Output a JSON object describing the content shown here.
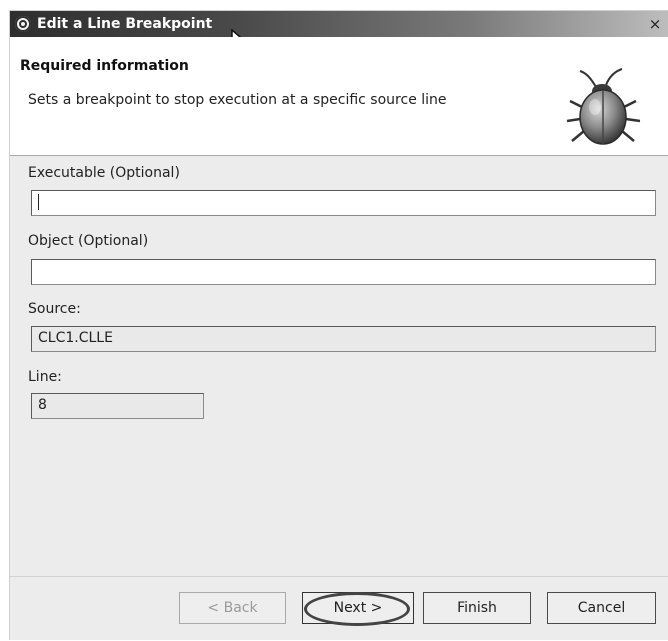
{
  "window": {
    "title": "Edit a Line Breakpoint",
    "close_label": "×"
  },
  "banner": {
    "title": "Required information",
    "description": "Sets a breakpoint to stop execution at a specific source line",
    "icon": "bug-icon"
  },
  "fields": {
    "executable": {
      "label": "Executable (Optional)",
      "value": ""
    },
    "object": {
      "label": "Object (Optional)",
      "value": ""
    },
    "source": {
      "label": "Source:",
      "value": "CLC1.CLLE"
    },
    "line": {
      "label": "Line:",
      "value": "8"
    }
  },
  "buttons": {
    "back": "< Back",
    "next": "Next >",
    "finish": "Finish",
    "cancel": "Cancel"
  },
  "colors": {
    "titlebar_dark": "#2e2e2e",
    "dialog_bg": "#ececec",
    "banner_bg": "#ffffff"
  }
}
